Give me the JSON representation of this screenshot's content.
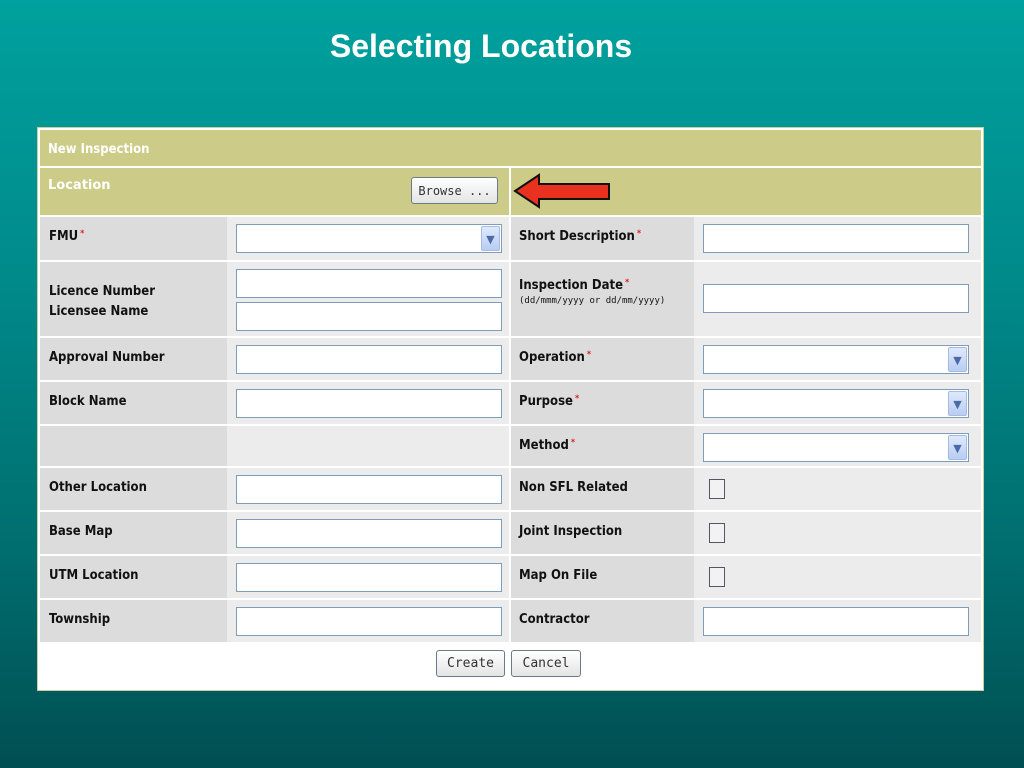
{
  "slide_title": "Selecting Locations",
  "form": {
    "title": "New Inspection",
    "location_label": "Location",
    "browse_label": "Browse ...",
    "left_fields": [
      {
        "label": "FMU",
        "required": "*",
        "type": "select",
        "value": ""
      },
      {
        "label": "Licence Number",
        "label2": "Licensee Name",
        "type": "double-text",
        "value": "",
        "value2": ""
      },
      {
        "label": "Approval Number",
        "type": "text",
        "value": ""
      },
      {
        "label": "Block Name",
        "type": "text",
        "value": ""
      },
      {
        "label": "",
        "type": "empty"
      },
      {
        "label": "Other Location",
        "type": "text",
        "value": ""
      },
      {
        "label": "Base Map",
        "type": "text",
        "value": ""
      },
      {
        "label": "UTM Location",
        "type": "text",
        "value": ""
      },
      {
        "label": "Township",
        "type": "text",
        "value": ""
      }
    ],
    "right_fields": [
      {
        "label": "Short Description",
        "required": "*",
        "type": "text",
        "value": ""
      },
      {
        "label": "Inspection Date",
        "required": "*",
        "hint": "(dd/mmm/yyyy or dd/mm/yyyy)",
        "type": "text",
        "value": ""
      },
      {
        "label": "Operation",
        "required": "*",
        "type": "select",
        "value": ""
      },
      {
        "label": "Purpose",
        "required": "*",
        "type": "select",
        "value": ""
      },
      {
        "label": "Method",
        "required": "*",
        "type": "select",
        "value": ""
      },
      {
        "label": "Non SFL Related",
        "type": "checkbox",
        "checked": false
      },
      {
        "label": "Joint Inspection",
        "type": "checkbox",
        "checked": false
      },
      {
        "label": "Map On File",
        "type": "checkbox",
        "checked": false
      },
      {
        "label": "Contractor",
        "type": "text",
        "value": ""
      }
    ],
    "create_label": "Create",
    "cancel_label": "Cancel"
  },
  "colors": {
    "background": "#008b8b",
    "header": "#cccc88",
    "arrow": "#e8311e",
    "required": "#dd2222"
  },
  "icons": [
    "dropdown-arrow-icon",
    "red-arrow-pointer"
  ]
}
